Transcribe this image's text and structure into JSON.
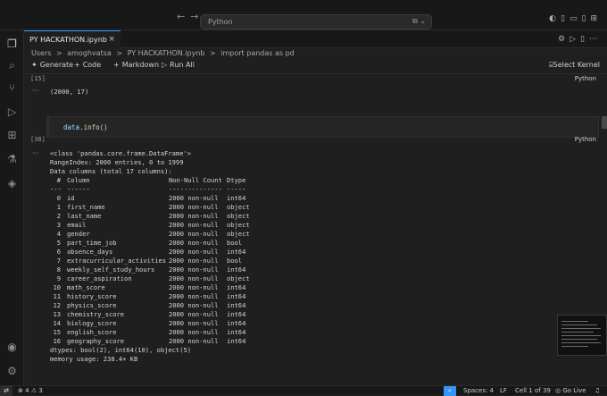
{
  "titlebar": {
    "search_text": "Python"
  },
  "tab": {
    "label": "PY HACKATHON.ipynb",
    "close": "×"
  },
  "breadcrumb": [
    "Users",
    ">",
    "amoghvatsa",
    ">",
    "PY HACKATHON.ipynb",
    ">",
    "import pandas as pd"
  ],
  "toolbar": {
    "generate": "Generate",
    "code": "Code",
    "markdown": "Markdown",
    "run_all": "Run All",
    "select_kernel": "Select Kernel"
  },
  "cell1": {
    "exec": "[15]",
    "lang": "Python",
    "ellipsis": "···",
    "output": "(2000, 17)"
  },
  "cell2": {
    "code_obj": "data",
    "code_fn": ".info",
    "code_args": "()"
  },
  "cell2_out": {
    "exec": "[38]",
    "lang": "Python",
    "ellipsis": "···",
    "lines": [
      "<class 'pandas.core.frame.DataFrame'>",
      "RangeIndex: 2000 entries, 0 to 1999",
      "Data columns (total 17 columns):"
    ],
    "header": [
      "#",
      "Column",
      "Non-Null Count",
      "Dtype"
    ],
    "underline": [
      "---",
      "------",
      "--------------",
      "-----"
    ],
    "rows": [
      [
        "0",
        "id",
        "2000 non-null",
        "int64"
      ],
      [
        "1",
        "first_name",
        "2000 non-null",
        "object"
      ],
      [
        "2",
        "last_name",
        "2000 non-null",
        "object"
      ],
      [
        "3",
        "email",
        "2000 non-null",
        "object"
      ],
      [
        "4",
        "gender",
        "2000 non-null",
        "object"
      ],
      [
        "5",
        "part_time_job",
        "2000 non-null",
        "bool"
      ],
      [
        "6",
        "absence_days",
        "2000 non-null",
        "int64"
      ],
      [
        "7",
        "extracurricular_activities",
        "2000 non-null",
        "bool"
      ],
      [
        "8",
        "weekly_self_study_hours",
        "2000 non-null",
        "int64"
      ],
      [
        "9",
        "career_aspiration",
        "2000 non-null",
        "object"
      ],
      [
        "10",
        "math_score",
        "2000 non-null",
        "int64"
      ],
      [
        "11",
        "history_score",
        "2000 non-null",
        "int64"
      ],
      [
        "12",
        "physics_score",
        "2000 non-null",
        "int64"
      ],
      [
        "13",
        "chemistry_score",
        "2000 non-null",
        "int64"
      ],
      [
        "14",
        "biology_score",
        "2000 non-null",
        "int64"
      ],
      [
        "15",
        "english_score",
        "2000 non-null",
        "int64"
      ],
      [
        "16",
        "geography_score",
        "2000 non-null",
        "int64"
      ]
    ],
    "footer": [
      "dtypes: bool(2), int64(10), object(5)",
      "memory usage: 238.4+ KB"
    ]
  },
  "statusbar": {
    "errors": "4",
    "warnings": "3",
    "spaces": "Spaces: 4",
    "encoding": "LF",
    "cell": "Cell 1 of 39",
    "golive": "Go Live"
  },
  "icons": [
    "explorer-icon",
    "search-icon",
    "source-control-icon",
    "run-debug-icon",
    "extensions-icon",
    "testing-icon",
    "python-icon",
    "account-icon",
    "settings-icon"
  ]
}
